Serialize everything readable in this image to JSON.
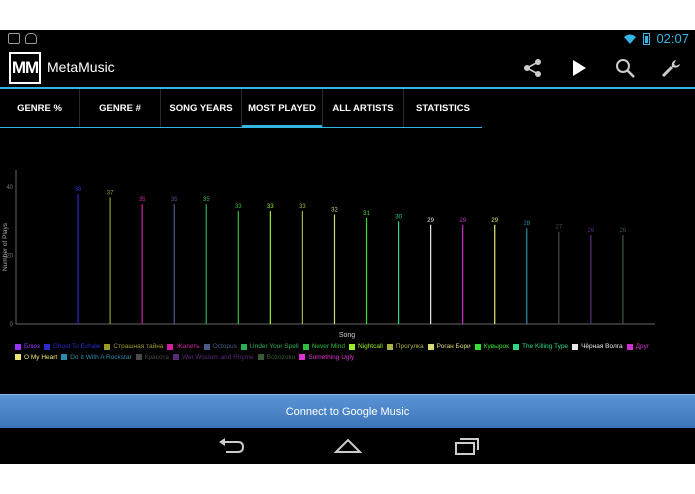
{
  "status_bar": {
    "time": "02:07",
    "left_icons": [
      "image-notification-icon",
      "android-notification-icon"
    ],
    "right_icons": [
      "wifi-icon",
      "battery-icon"
    ]
  },
  "app": {
    "logo_text": "MM",
    "title": "MetaMusic",
    "actions": [
      "share-icon",
      "play-icon",
      "search-icon",
      "settings-wrench-icon"
    ]
  },
  "tabs": [
    {
      "label": "GENRE %",
      "active": false
    },
    {
      "label": "GENRE #",
      "active": false
    },
    {
      "label": "SONG YEARS",
      "active": false
    },
    {
      "label": "MOST PLAYED",
      "active": true
    },
    {
      "label": "ALL ARTISTS",
      "active": false
    },
    {
      "label": "STATISTICS",
      "active": false
    }
  ],
  "chart_data": {
    "type": "bar",
    "xlabel": "Song",
    "ylabel": "Number of Plays",
    "ylim": [
      0,
      45
    ],
    "yticks": [
      0,
      20,
      40
    ],
    "grid": false,
    "legend_placement": "bottom",
    "categories": [
      "Блюз",
      "Ghost To Exhale",
      "Страшная тайна",
      "Жалеть",
      "Octopus",
      "Under Your Spell",
      "Never Mind",
      "Nightcall",
      "Прогулка",
      "Роган Бори",
      "Кувырок",
      "The Killing Type",
      "Чёрная Волга",
      "Друг",
      "O My Heart",
      "Do It With A Rockstar",
      "Красота",
      "Wet Wisdom and Rhyme",
      "Bozozoku",
      "Something Ugly"
    ],
    "values": [
      null,
      38,
      37,
      35,
      35,
      35,
      33,
      33,
      33,
      32,
      31,
      30,
      29,
      29,
      29,
      28,
      27,
      26,
      26,
      null
    ],
    "colors": [
      "#9b30ff",
      "#2a2acd",
      "#9a9a2a",
      "#d020a0",
      "#4a5a8a",
      "#2eae56",
      "#2ebe3e",
      "#9aee2a",
      "#a8b048",
      "#d8d878",
      "#33e033",
      "#2ad888",
      "#e8e8e8",
      "#d030d0",
      "#e8e878",
      "#2a8aaa",
      "#4a4a4a",
      "#5a2a7a",
      "#3a5a3a",
      "#e030d0"
    ]
  },
  "connect_button": {
    "label": "Connect to Google Music"
  },
  "nav": [
    "back-icon",
    "home-icon",
    "recent-apps-icon"
  ]
}
